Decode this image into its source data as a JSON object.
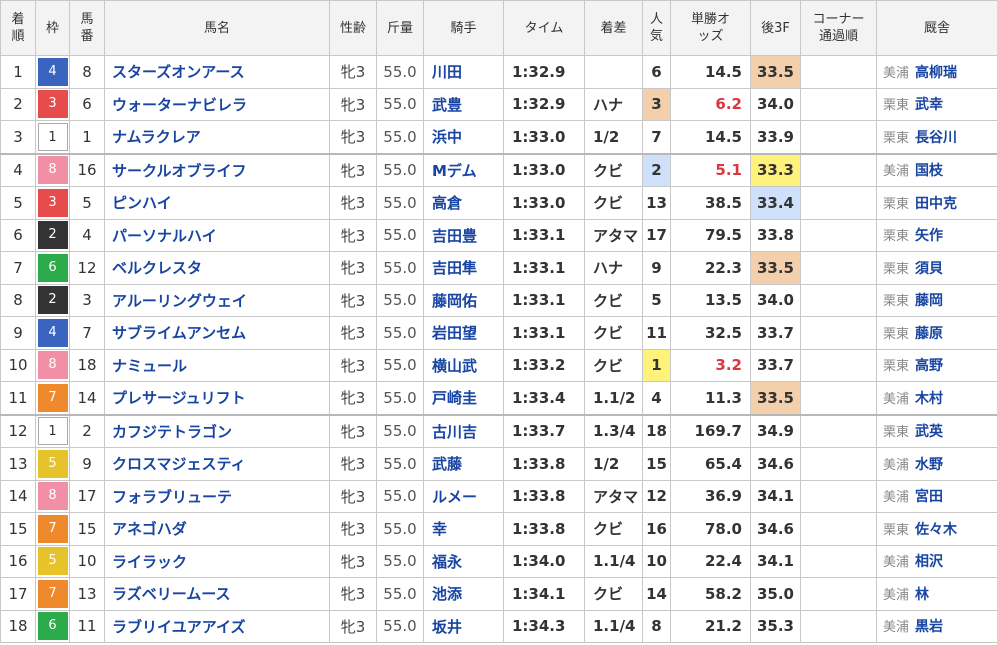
{
  "headers": {
    "rank": "着順",
    "waku": "枠",
    "umaban": "馬番",
    "name": "馬名",
    "sexage": "性齢",
    "weight": "斤量",
    "jockey": "騎手",
    "time": "タイム",
    "margin": "着差",
    "popularity": "人気",
    "odds": "単勝オッズ",
    "last3f": "後3F",
    "corner": "コーナー通過順",
    "stable": "厩舎"
  },
  "colors": {
    "waku1": "#ffffff",
    "waku2": "#333333",
    "waku3": "#e74c4c",
    "waku4": "#3a64c0",
    "waku5": "#e6c32b",
    "waku6": "#2bab4a",
    "waku7": "#ef8a2c",
    "waku8": "#f08fa6",
    "highlight_1st": "#fff27a",
    "highlight_2nd": "#cfe0fb",
    "highlight_3rd": "#f4cfac",
    "link": "#1845a2",
    "favored_odds": "#d9363e"
  },
  "rows": [
    {
      "rank": "1",
      "waku": "4",
      "umaban": "8",
      "name": "スターズオンアース",
      "sexage": "牝3",
      "weight": "55.0",
      "jockey": "川田",
      "time": "1:32.9",
      "margin": "",
      "popularity": "6",
      "odds": "14.5",
      "last3f": "33.5",
      "corner": "",
      "region": "美浦",
      "trainer": "高柳瑞",
      "pop_hl": "",
      "odds_fav": false,
      "last3f_hl": "bronze",
      "sep": false
    },
    {
      "rank": "2",
      "waku": "3",
      "umaban": "6",
      "name": "ウォーターナビレラ",
      "sexage": "牝3",
      "weight": "55.0",
      "jockey": "武豊",
      "time": "1:32.9",
      "margin": "ハナ",
      "popularity": "3",
      "odds": "6.2",
      "last3f": "34.0",
      "corner": "",
      "region": "栗東",
      "trainer": "武幸",
      "pop_hl": "bronze",
      "odds_fav": true,
      "last3f_hl": "",
      "sep": false
    },
    {
      "rank": "3",
      "waku": "1",
      "umaban": "1",
      "name": "ナムラクレア",
      "sexage": "牝3",
      "weight": "55.0",
      "jockey": "浜中",
      "time": "1:33.0",
      "margin": "1/2",
      "popularity": "7",
      "odds": "14.5",
      "last3f": "33.9",
      "corner": "",
      "region": "栗東",
      "trainer": "長谷川",
      "pop_hl": "",
      "odds_fav": false,
      "last3f_hl": "",
      "sep": false
    },
    {
      "rank": "4",
      "waku": "8",
      "umaban": "16",
      "name": "サークルオブライフ",
      "sexage": "牝3",
      "weight": "55.0",
      "jockey": "Mデム",
      "time": "1:33.0",
      "margin": "クビ",
      "popularity": "2",
      "odds": "5.1",
      "last3f": "33.3",
      "corner": "",
      "region": "美浦",
      "trainer": "国枝",
      "pop_hl": "silver",
      "odds_fav": true,
      "last3f_hl": "gold",
      "sep": true
    },
    {
      "rank": "5",
      "waku": "3",
      "umaban": "5",
      "name": "ピンハイ",
      "sexage": "牝3",
      "weight": "55.0",
      "jockey": "高倉",
      "time": "1:33.0",
      "margin": "クビ",
      "popularity": "13",
      "odds": "38.5",
      "last3f": "33.4",
      "corner": "",
      "region": "栗東",
      "trainer": "田中克",
      "pop_hl": "",
      "odds_fav": false,
      "last3f_hl": "silver",
      "sep": false
    },
    {
      "rank": "6",
      "waku": "2",
      "umaban": "4",
      "name": "パーソナルハイ",
      "sexage": "牝3",
      "weight": "55.0",
      "jockey": "吉田豊",
      "time": "1:33.1",
      "margin": "アタマ",
      "popularity": "17",
      "odds": "79.5",
      "last3f": "33.8",
      "corner": "",
      "region": "栗東",
      "trainer": "矢作",
      "pop_hl": "",
      "odds_fav": false,
      "last3f_hl": "",
      "sep": false
    },
    {
      "rank": "7",
      "waku": "6",
      "umaban": "12",
      "name": "ベルクレスタ",
      "sexage": "牝3",
      "weight": "55.0",
      "jockey": "吉田隼",
      "time": "1:33.1",
      "margin": "ハナ",
      "popularity": "9",
      "odds": "22.3",
      "last3f": "33.5",
      "corner": "",
      "region": "栗東",
      "trainer": "須貝",
      "pop_hl": "",
      "odds_fav": false,
      "last3f_hl": "bronze",
      "sep": false
    },
    {
      "rank": "8",
      "waku": "2",
      "umaban": "3",
      "name": "アルーリングウェイ",
      "sexage": "牝3",
      "weight": "55.0",
      "jockey": "藤岡佑",
      "time": "1:33.1",
      "margin": "クビ",
      "popularity": "5",
      "odds": "13.5",
      "last3f": "34.0",
      "corner": "",
      "region": "栗東",
      "trainer": "藤岡",
      "pop_hl": "",
      "odds_fav": false,
      "last3f_hl": "",
      "sep": false
    },
    {
      "rank": "9",
      "waku": "4",
      "umaban": "7",
      "name": "サブライムアンセム",
      "sexage": "牝3",
      "weight": "55.0",
      "jockey": "岩田望",
      "time": "1:33.1",
      "margin": "クビ",
      "popularity": "11",
      "odds": "32.5",
      "last3f": "33.7",
      "corner": "",
      "region": "栗東",
      "trainer": "藤原",
      "pop_hl": "",
      "odds_fav": false,
      "last3f_hl": "",
      "sep": false
    },
    {
      "rank": "10",
      "waku": "8",
      "umaban": "18",
      "name": "ナミュール",
      "sexage": "牝3",
      "weight": "55.0",
      "jockey": "横山武",
      "time": "1:33.2",
      "margin": "クビ",
      "popularity": "1",
      "odds": "3.2",
      "last3f": "33.7",
      "corner": "",
      "region": "栗東",
      "trainer": "高野",
      "pop_hl": "gold",
      "odds_fav": true,
      "last3f_hl": "",
      "sep": false
    },
    {
      "rank": "11",
      "waku": "7",
      "umaban": "14",
      "name": "プレサージュリフト",
      "sexage": "牝3",
      "weight": "55.0",
      "jockey": "戸崎圭",
      "time": "1:33.4",
      "margin": "1.1/2",
      "popularity": "4",
      "odds": "11.3",
      "last3f": "33.5",
      "corner": "",
      "region": "美浦",
      "trainer": "木村",
      "pop_hl": "",
      "odds_fav": false,
      "last3f_hl": "bronze",
      "sep": false
    },
    {
      "rank": "12",
      "waku": "1",
      "umaban": "2",
      "name": "カフジテトラゴン",
      "sexage": "牝3",
      "weight": "55.0",
      "jockey": "古川吉",
      "time": "1:33.7",
      "margin": "1.3/4",
      "popularity": "18",
      "odds": "169.7",
      "last3f": "34.9",
      "corner": "",
      "region": "栗東",
      "trainer": "武英",
      "pop_hl": "",
      "odds_fav": false,
      "last3f_hl": "",
      "sep": true
    },
    {
      "rank": "13",
      "waku": "5",
      "umaban": "9",
      "name": "クロスマジェスティ",
      "sexage": "牝3",
      "weight": "55.0",
      "jockey": "武藤",
      "time": "1:33.8",
      "margin": "1/2",
      "popularity": "15",
      "odds": "65.4",
      "last3f": "34.6",
      "corner": "",
      "region": "美浦",
      "trainer": "水野",
      "pop_hl": "",
      "odds_fav": false,
      "last3f_hl": "",
      "sep": false
    },
    {
      "rank": "14",
      "waku": "8",
      "umaban": "17",
      "name": "フォラブリューテ",
      "sexage": "牝3",
      "weight": "55.0",
      "jockey": "ルメー",
      "time": "1:33.8",
      "margin": "アタマ",
      "popularity": "12",
      "odds": "36.9",
      "last3f": "34.1",
      "corner": "",
      "region": "美浦",
      "trainer": "宮田",
      "pop_hl": "",
      "odds_fav": false,
      "last3f_hl": "",
      "sep": false
    },
    {
      "rank": "15",
      "waku": "7",
      "umaban": "15",
      "name": "アネゴハダ",
      "sexage": "牝3",
      "weight": "55.0",
      "jockey": "幸",
      "time": "1:33.8",
      "margin": "クビ",
      "popularity": "16",
      "odds": "78.0",
      "last3f": "34.6",
      "corner": "",
      "region": "栗東",
      "trainer": "佐々木",
      "pop_hl": "",
      "odds_fav": false,
      "last3f_hl": "",
      "sep": false
    },
    {
      "rank": "16",
      "waku": "5",
      "umaban": "10",
      "name": "ライラック",
      "sexage": "牝3",
      "weight": "55.0",
      "jockey": "福永",
      "time": "1:34.0",
      "margin": "1.1/4",
      "popularity": "10",
      "odds": "22.4",
      "last3f": "34.1",
      "corner": "",
      "region": "美浦",
      "trainer": "相沢",
      "pop_hl": "",
      "odds_fav": false,
      "last3f_hl": "",
      "sep": false
    },
    {
      "rank": "17",
      "waku": "7",
      "umaban": "13",
      "name": "ラズベリームース",
      "sexage": "牝3",
      "weight": "55.0",
      "jockey": "池添",
      "time": "1:34.1",
      "margin": "クビ",
      "popularity": "14",
      "odds": "58.2",
      "last3f": "35.0",
      "corner": "",
      "region": "美浦",
      "trainer": "林",
      "pop_hl": "",
      "odds_fav": false,
      "last3f_hl": "",
      "sep": false
    },
    {
      "rank": "18",
      "waku": "6",
      "umaban": "11",
      "name": "ラブリイユアアイズ",
      "sexage": "牝3",
      "weight": "55.0",
      "jockey": "坂井",
      "time": "1:34.3",
      "margin": "1.1/4",
      "popularity": "8",
      "odds": "21.2",
      "last3f": "35.3",
      "corner": "",
      "region": "美浦",
      "trainer": "黒岩",
      "pop_hl": "",
      "odds_fav": false,
      "last3f_hl": "",
      "sep": false
    }
  ]
}
